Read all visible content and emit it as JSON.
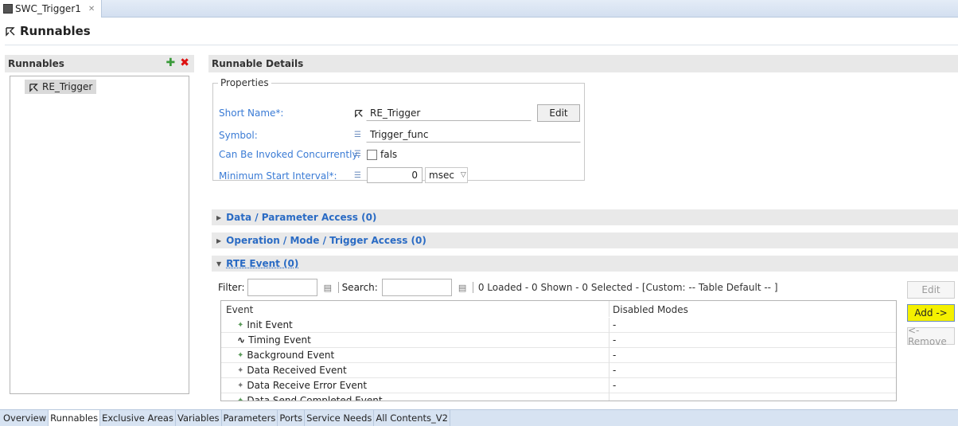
{
  "editor_tab": {
    "title": "SWC_Trigger1",
    "close": "✕"
  },
  "page_title": "Runnables",
  "left": {
    "header": "Runnables",
    "items": [
      {
        "label": "RE_Trigger"
      }
    ]
  },
  "details": {
    "header": "Runnable Details",
    "properties_legend": "Properties",
    "short_name_label": "Short Name*:",
    "short_name_value": "RE_Trigger",
    "edit_label": "Edit",
    "symbol_label": "Symbol:",
    "symbol_value": "Trigger_func",
    "concurrent_label": "Can Be Invoked Concurrently:",
    "concurrent_value": "fals",
    "min_interval_label": "Minimum Start Interval*:",
    "min_interval_value": "0",
    "min_interval_unit": "msec"
  },
  "sections": {
    "data_access": "Data / Parameter Access (0)",
    "operation_access": "Operation / Mode / Trigger Access (0)",
    "rte_event": "RTE Event (0)"
  },
  "filter_bar": {
    "filter_label": "Filter:",
    "search_label": "Search:",
    "status": "0 Loaded - 0 Shown - 0 Selected -  [Custom: -- Table Default -- ]"
  },
  "table": {
    "col_event": "Event",
    "col_modes": "Disabled Modes",
    "rows": [
      {
        "event": "Init Event",
        "modes": "-"
      },
      {
        "event": "Timing Event",
        "modes": "-"
      },
      {
        "event": "Background Event",
        "modes": "-"
      },
      {
        "event": "Data Received Event",
        "modes": "-"
      },
      {
        "event": "Data Receive Error Event",
        "modes": "-"
      },
      {
        "event": "Data Send Completed Event",
        "modes": "-"
      }
    ]
  },
  "side_buttons": {
    "edit": "Edit",
    "add": "Add ->",
    "remove": "<- Remove"
  },
  "bottom_tabs": [
    "Overview",
    "Runnables",
    "Exclusive Areas",
    "Variables",
    "Parameters",
    "Ports",
    "Service Needs",
    "All Contents_V2"
  ],
  "colors": {
    "link_blue": "#3a7bd5",
    "highlight_yellow": "#f4f000"
  }
}
